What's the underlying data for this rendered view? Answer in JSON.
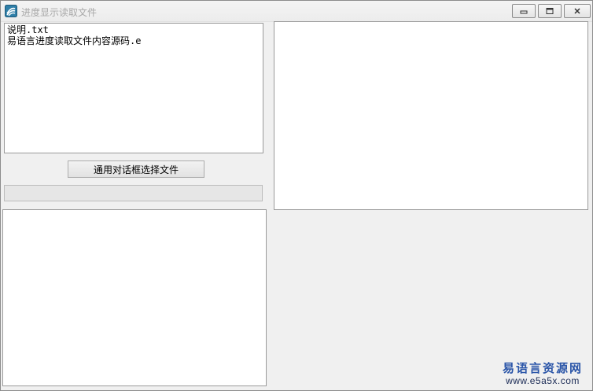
{
  "window": {
    "title": "进度显示读取文件",
    "icon": "app-logo-icon",
    "controls": {
      "minimize_icon": "minimize-icon",
      "maximize_icon": "maximize-icon",
      "close_icon": "close-icon"
    }
  },
  "file_list": {
    "items": [
      "说明.txt",
      "易语言进度读取文件内容源码.e"
    ]
  },
  "choose_button": {
    "label": "通用对话框选择文件"
  },
  "progress": {
    "value": 0,
    "fill_color": "#06b025"
  },
  "content_box": {
    "text": ""
  },
  "log_box": {
    "text": ""
  },
  "watermark": {
    "line1": "易语言资源网",
    "line2": "www.e5a5x.com",
    "color": "#2a55a8"
  }
}
